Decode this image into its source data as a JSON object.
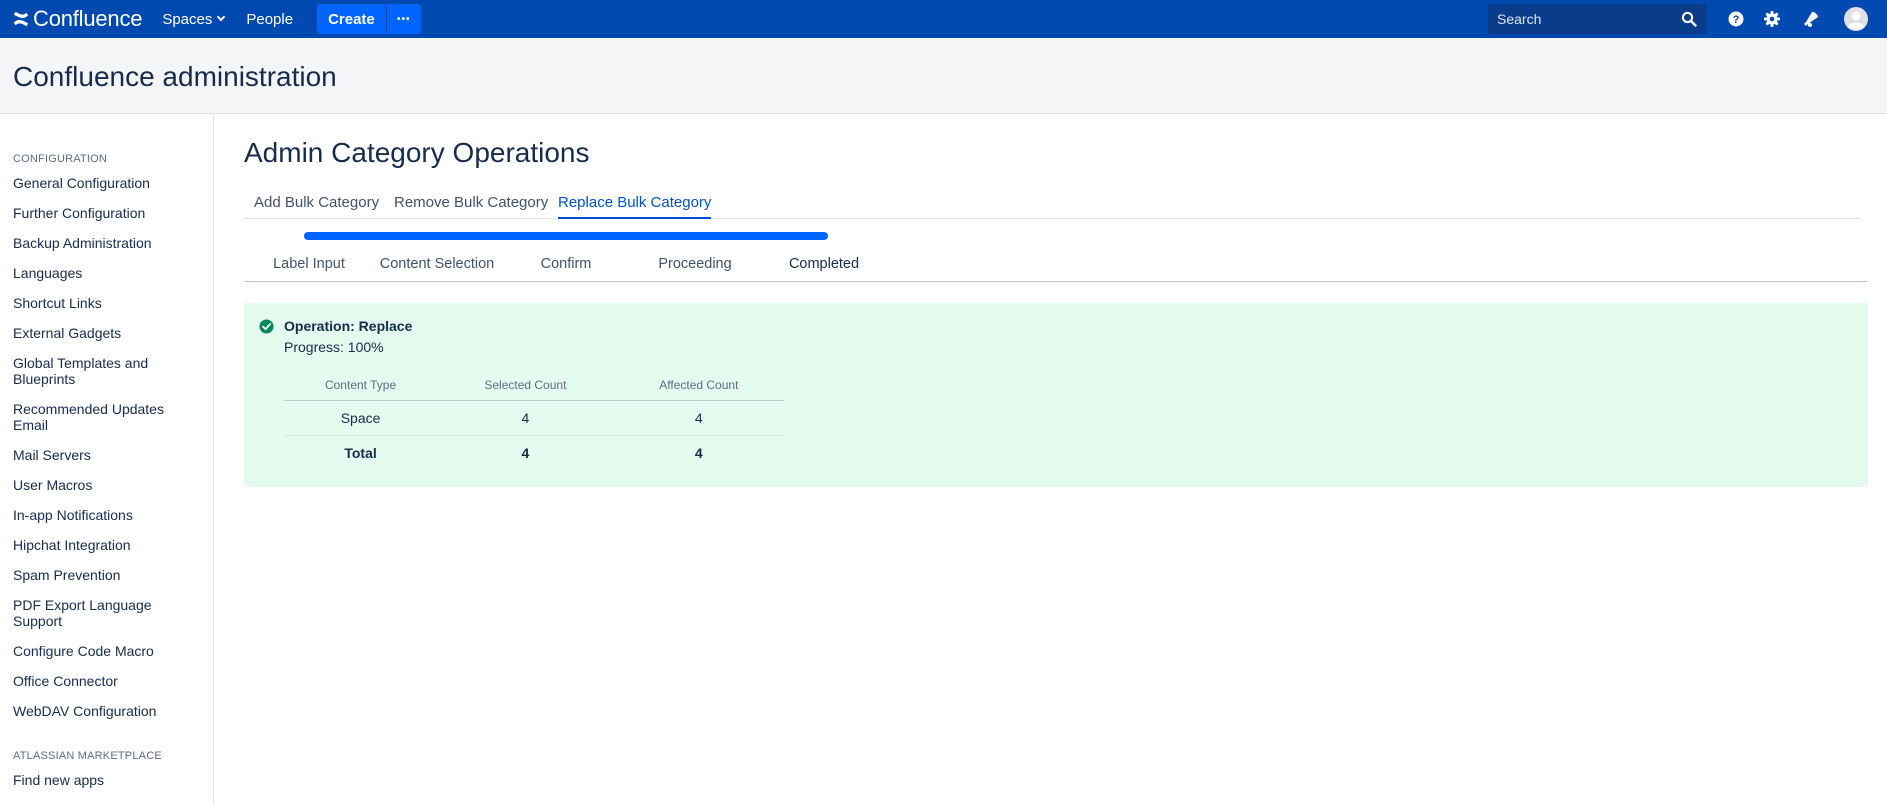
{
  "topnav": {
    "logo_text": "Confluence",
    "logo_icon": "confluence-logo-icon",
    "spaces_label": "Spaces",
    "people_label": "People",
    "create_label": "Create",
    "more_label": "•••",
    "search_placeholder": "Search",
    "icons": [
      "search-icon",
      "help-icon",
      "settings-icon",
      "notifications-icon",
      "avatar"
    ],
    "bg_color": "#0049b0",
    "accent_color": "#0065ff"
  },
  "header": {
    "title": "Confluence administration"
  },
  "sidebar": {
    "sections": [
      {
        "title": "CONFIGURATION",
        "items": [
          "General Configuration",
          "Further Configuration",
          "Backup Administration",
          "Languages",
          "Shortcut Links",
          "External Gadgets",
          "Global Templates and Blueprints",
          "Recommended Updates Email",
          "Mail Servers",
          "User Macros",
          "In-app Notifications",
          "Hipchat Integration",
          "Spam Prevention",
          "PDF Export Language Support",
          "Configure Code Macro",
          "Office Connector",
          "WebDAV Configuration"
        ]
      },
      {
        "title": "ATLASSIAN MARKETPLACE",
        "items": [
          "Find new apps"
        ]
      }
    ]
  },
  "main": {
    "title": "Admin Category Operations",
    "tabs": [
      {
        "label": "Add Bulk Category",
        "active": false
      },
      {
        "label": "Remove Bulk Category",
        "active": false
      },
      {
        "label": "Replace Bulk Category",
        "active": true
      }
    ],
    "steps": [
      "Label Input",
      "Content Selection",
      "Confirm",
      "Proceeding",
      "Completed"
    ],
    "current_step": "Completed",
    "result": {
      "status_icon": "check-circle-icon",
      "operation": "Operation: Replace",
      "progress_text": "Progress: 100%",
      "progress": 1.0,
      "columns": [
        "Content Type",
        "Selected Count",
        "Affected Count"
      ],
      "rows": [
        [
          "Space",
          "4",
          "4"
        ]
      ],
      "total": [
        "Total",
        "4",
        "4"
      ],
      "bg_color": "#e3fcef",
      "success_color": "#00875a"
    }
  }
}
